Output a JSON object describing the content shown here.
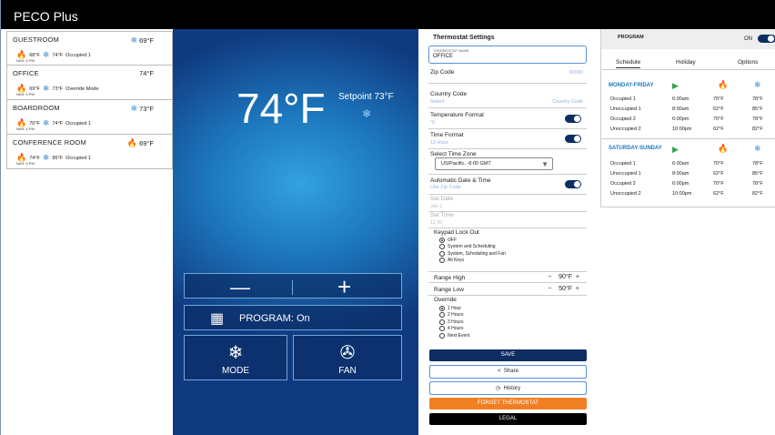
{
  "app": {
    "title": "PECO Plus"
  },
  "rooms": [
    {
      "name": "GUESTROOM",
      "temp": "69°F",
      "temp_icon": "snowflake-icon",
      "heat": "68°F",
      "cool": "74°F",
      "status": "Occupied 1",
      "next": "Next: 6 PM"
    },
    {
      "name": "OFFICE",
      "temp": "74°F",
      "temp_icon": "",
      "heat": "69°F",
      "cool": "73°F",
      "status": "Override Mode",
      "next": "Next: 6 PM"
    },
    {
      "name": "BOARDROOM",
      "temp": "73°F",
      "temp_icon": "snowflake-icon",
      "heat": "70°F",
      "cool": "74°F",
      "status": "Occupied 1",
      "next": "Next: 6 PM"
    },
    {
      "name": "CONFERENCE ROOM",
      "temp": "69°F",
      "temp_icon": "flame-icon",
      "heat": "74°F",
      "cool": "85°F",
      "status": "Occupied 1",
      "next": "Next: 6 PM"
    }
  ],
  "main": {
    "current_temp": "74°F",
    "setpoint": "Setpoint 73°F",
    "minus": "—",
    "plus": "+",
    "program_label": "PROGRAM: On",
    "mode_label": "MODE",
    "fan_label": "FAN"
  },
  "settings": {
    "title": "Thermostat Settings",
    "name_label": "THERMOSTAT NAME",
    "name_value": "OFFICE",
    "zip_label": "Zip Code",
    "zip_value": "00000",
    "country_label": "Country Code",
    "country_sub": "Select",
    "country_value": "Country Code",
    "temp_format_label": "Temperature Format",
    "temp_format_sub": "°F",
    "time_format_label": "Time Format",
    "time_format_sub": "12 Hour",
    "timezone_label": "Select Time Zone",
    "timezone_value": "US/Pacific, -8:00 GMT",
    "auto_dt_label": "Automatic Date & Time",
    "auto_dt_sub": "Use Zip Code",
    "set_date_label": "Set Date",
    "set_date_value": "Jan 1",
    "set_time_label": "Set Time",
    "set_time_value": "11:30",
    "keypad_label": "Keypad Lock Out",
    "keypad_options": [
      "OFF",
      "System and Scheduling",
      "System, Scheduling and Fan",
      "All Keys"
    ],
    "keypad_selected": 0,
    "range_high_label": "Range High",
    "range_high_value": "90°F",
    "range_low_label": "Range Low",
    "range_low_value": "50°F",
    "override_label": "Override",
    "override_options": [
      "1 Hour",
      "2 Hours",
      "3 Hours",
      "4 Hours",
      "Next Event"
    ],
    "override_selected": 0,
    "save": "SAVE",
    "share": "Share",
    "history": "History",
    "forget": "FORGET THERMOSTAT",
    "legal": "LEGAL"
  },
  "program": {
    "title": "PROGRAM",
    "on_label": "ON",
    "tabs": [
      "Schedule",
      "Holiday",
      "Options"
    ],
    "weekday_title": "MONDAY-FRIDAY",
    "weekday_rows": [
      [
        "Occupied 1",
        "6:00am",
        "70°F",
        "78°F"
      ],
      [
        "Unoccupied 1",
        "8:00am",
        "62°F",
        "85°F"
      ],
      [
        "Occupied 2",
        "6:00pm",
        "70°F",
        "78°F"
      ],
      [
        "Unoccupied 2",
        "10:00pm",
        "62°F",
        "82°F"
      ]
    ],
    "weekend_title": "SATURDAY-SUNDAY",
    "weekend_rows": [
      [
        "Occupied 1",
        "6:00am",
        "70°F",
        "78°F"
      ],
      [
        "Unoccupied 1",
        "8:00am",
        "62°F",
        "85°F"
      ],
      [
        "Occupied 2",
        "6:00pm",
        "70°F",
        "78°F"
      ],
      [
        "Unoccupied 2",
        "10:00pm",
        "62°F",
        "82°F"
      ]
    ]
  }
}
